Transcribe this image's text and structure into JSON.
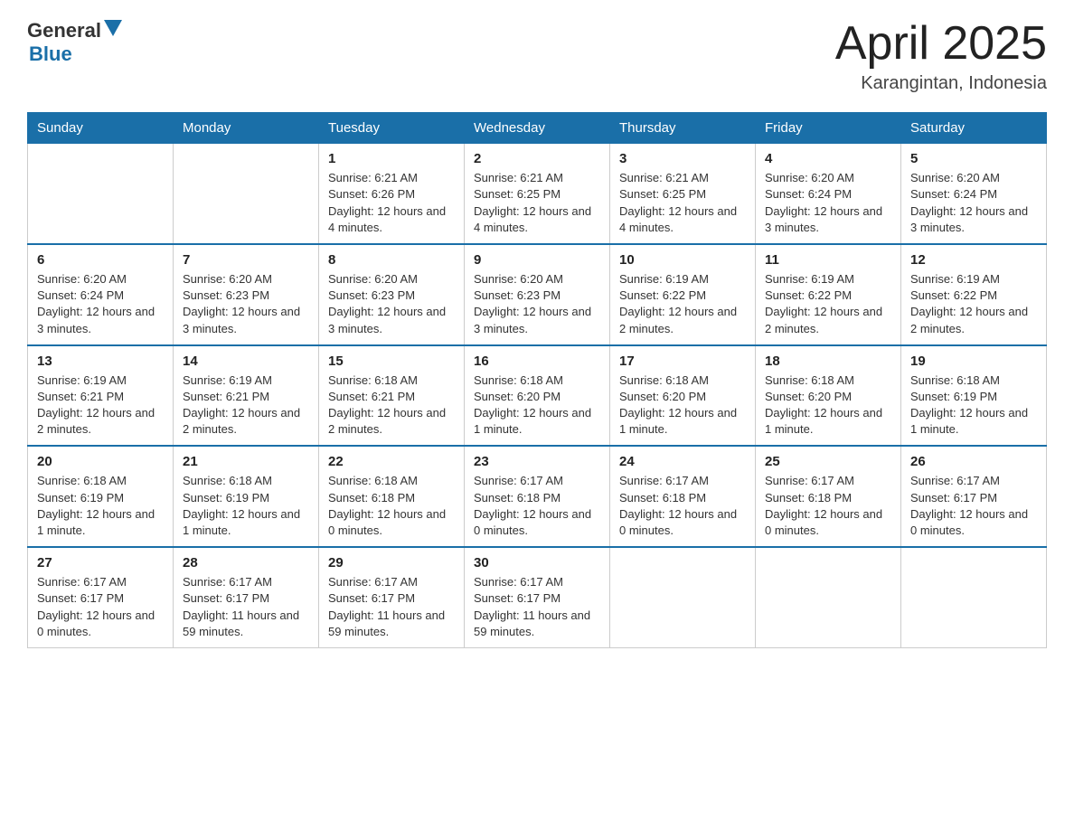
{
  "header": {
    "logo_general": "General",
    "logo_blue": "Blue",
    "title": "April 2025",
    "location": "Karangintan, Indonesia"
  },
  "days_of_week": [
    "Sunday",
    "Monday",
    "Tuesday",
    "Wednesday",
    "Thursday",
    "Friday",
    "Saturday"
  ],
  "weeks": [
    [
      {
        "day": "",
        "sunrise": "",
        "sunset": "",
        "daylight": ""
      },
      {
        "day": "",
        "sunrise": "",
        "sunset": "",
        "daylight": ""
      },
      {
        "day": "1",
        "sunrise": "Sunrise: 6:21 AM",
        "sunset": "Sunset: 6:26 PM",
        "daylight": "Daylight: 12 hours and 4 minutes."
      },
      {
        "day": "2",
        "sunrise": "Sunrise: 6:21 AM",
        "sunset": "Sunset: 6:25 PM",
        "daylight": "Daylight: 12 hours and 4 minutes."
      },
      {
        "day": "3",
        "sunrise": "Sunrise: 6:21 AM",
        "sunset": "Sunset: 6:25 PM",
        "daylight": "Daylight: 12 hours and 4 minutes."
      },
      {
        "day": "4",
        "sunrise": "Sunrise: 6:20 AM",
        "sunset": "Sunset: 6:24 PM",
        "daylight": "Daylight: 12 hours and 3 minutes."
      },
      {
        "day": "5",
        "sunrise": "Sunrise: 6:20 AM",
        "sunset": "Sunset: 6:24 PM",
        "daylight": "Daylight: 12 hours and 3 minutes."
      }
    ],
    [
      {
        "day": "6",
        "sunrise": "Sunrise: 6:20 AM",
        "sunset": "Sunset: 6:24 PM",
        "daylight": "Daylight: 12 hours and 3 minutes."
      },
      {
        "day": "7",
        "sunrise": "Sunrise: 6:20 AM",
        "sunset": "Sunset: 6:23 PM",
        "daylight": "Daylight: 12 hours and 3 minutes."
      },
      {
        "day": "8",
        "sunrise": "Sunrise: 6:20 AM",
        "sunset": "Sunset: 6:23 PM",
        "daylight": "Daylight: 12 hours and 3 minutes."
      },
      {
        "day": "9",
        "sunrise": "Sunrise: 6:20 AM",
        "sunset": "Sunset: 6:23 PM",
        "daylight": "Daylight: 12 hours and 3 minutes."
      },
      {
        "day": "10",
        "sunrise": "Sunrise: 6:19 AM",
        "sunset": "Sunset: 6:22 PM",
        "daylight": "Daylight: 12 hours and 2 minutes."
      },
      {
        "day": "11",
        "sunrise": "Sunrise: 6:19 AM",
        "sunset": "Sunset: 6:22 PM",
        "daylight": "Daylight: 12 hours and 2 minutes."
      },
      {
        "day": "12",
        "sunrise": "Sunrise: 6:19 AM",
        "sunset": "Sunset: 6:22 PM",
        "daylight": "Daylight: 12 hours and 2 minutes."
      }
    ],
    [
      {
        "day": "13",
        "sunrise": "Sunrise: 6:19 AM",
        "sunset": "Sunset: 6:21 PM",
        "daylight": "Daylight: 12 hours and 2 minutes."
      },
      {
        "day": "14",
        "sunrise": "Sunrise: 6:19 AM",
        "sunset": "Sunset: 6:21 PM",
        "daylight": "Daylight: 12 hours and 2 minutes."
      },
      {
        "day": "15",
        "sunrise": "Sunrise: 6:18 AM",
        "sunset": "Sunset: 6:21 PM",
        "daylight": "Daylight: 12 hours and 2 minutes."
      },
      {
        "day": "16",
        "sunrise": "Sunrise: 6:18 AM",
        "sunset": "Sunset: 6:20 PM",
        "daylight": "Daylight: 12 hours and 1 minute."
      },
      {
        "day": "17",
        "sunrise": "Sunrise: 6:18 AM",
        "sunset": "Sunset: 6:20 PM",
        "daylight": "Daylight: 12 hours and 1 minute."
      },
      {
        "day": "18",
        "sunrise": "Sunrise: 6:18 AM",
        "sunset": "Sunset: 6:20 PM",
        "daylight": "Daylight: 12 hours and 1 minute."
      },
      {
        "day": "19",
        "sunrise": "Sunrise: 6:18 AM",
        "sunset": "Sunset: 6:19 PM",
        "daylight": "Daylight: 12 hours and 1 minute."
      }
    ],
    [
      {
        "day": "20",
        "sunrise": "Sunrise: 6:18 AM",
        "sunset": "Sunset: 6:19 PM",
        "daylight": "Daylight: 12 hours and 1 minute."
      },
      {
        "day": "21",
        "sunrise": "Sunrise: 6:18 AM",
        "sunset": "Sunset: 6:19 PM",
        "daylight": "Daylight: 12 hours and 1 minute."
      },
      {
        "day": "22",
        "sunrise": "Sunrise: 6:18 AM",
        "sunset": "Sunset: 6:18 PM",
        "daylight": "Daylight: 12 hours and 0 minutes."
      },
      {
        "day": "23",
        "sunrise": "Sunrise: 6:17 AM",
        "sunset": "Sunset: 6:18 PM",
        "daylight": "Daylight: 12 hours and 0 minutes."
      },
      {
        "day": "24",
        "sunrise": "Sunrise: 6:17 AM",
        "sunset": "Sunset: 6:18 PM",
        "daylight": "Daylight: 12 hours and 0 minutes."
      },
      {
        "day": "25",
        "sunrise": "Sunrise: 6:17 AM",
        "sunset": "Sunset: 6:18 PM",
        "daylight": "Daylight: 12 hours and 0 minutes."
      },
      {
        "day": "26",
        "sunrise": "Sunrise: 6:17 AM",
        "sunset": "Sunset: 6:17 PM",
        "daylight": "Daylight: 12 hours and 0 minutes."
      }
    ],
    [
      {
        "day": "27",
        "sunrise": "Sunrise: 6:17 AM",
        "sunset": "Sunset: 6:17 PM",
        "daylight": "Daylight: 12 hours and 0 minutes."
      },
      {
        "day": "28",
        "sunrise": "Sunrise: 6:17 AM",
        "sunset": "Sunset: 6:17 PM",
        "daylight": "Daylight: 11 hours and 59 minutes."
      },
      {
        "day": "29",
        "sunrise": "Sunrise: 6:17 AM",
        "sunset": "Sunset: 6:17 PM",
        "daylight": "Daylight: 11 hours and 59 minutes."
      },
      {
        "day": "30",
        "sunrise": "Sunrise: 6:17 AM",
        "sunset": "Sunset: 6:17 PM",
        "daylight": "Daylight: 11 hours and 59 minutes."
      },
      {
        "day": "",
        "sunrise": "",
        "sunset": "",
        "daylight": ""
      },
      {
        "day": "",
        "sunrise": "",
        "sunset": "",
        "daylight": ""
      },
      {
        "day": "",
        "sunrise": "",
        "sunset": "",
        "daylight": ""
      }
    ]
  ]
}
